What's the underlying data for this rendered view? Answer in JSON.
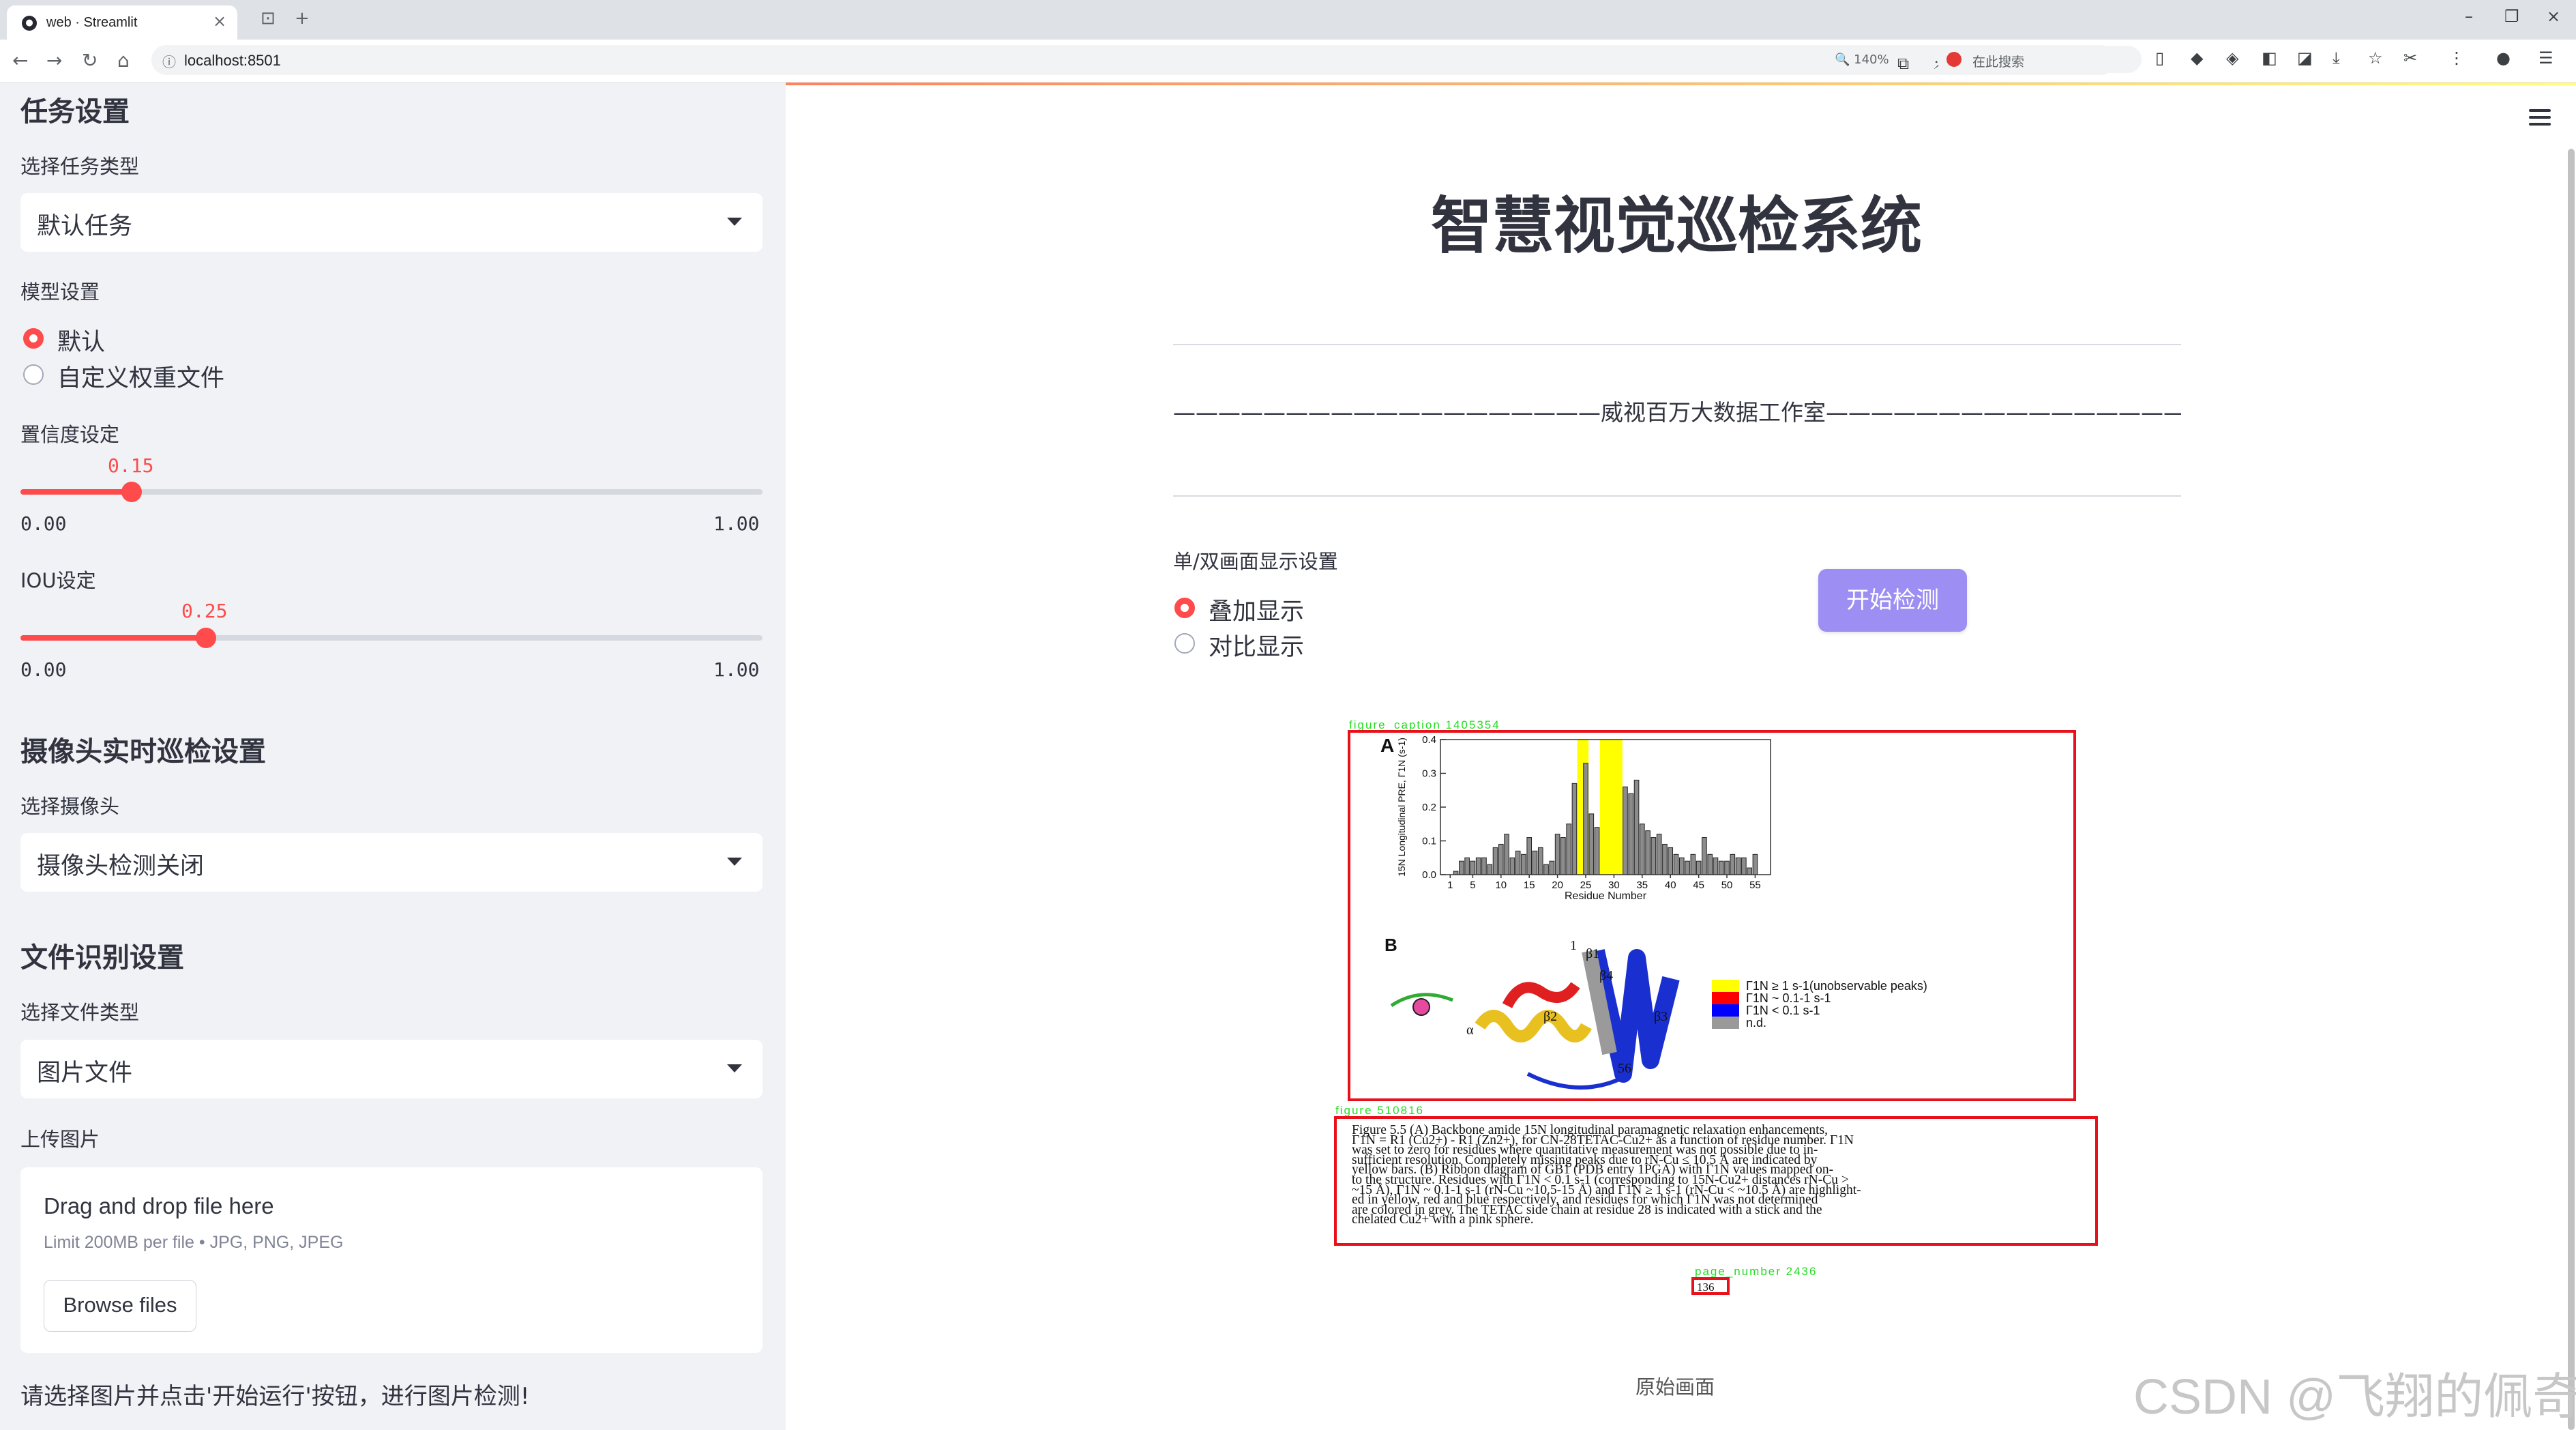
{
  "browser": {
    "tab_title": "web · Streamlit",
    "url": "localhost:8501",
    "zoom": "140%",
    "search_placeholder": "在此搜索"
  },
  "sidebar": {
    "task_heading": "任务设置",
    "task_type_label": "选择任务类型",
    "task_type_value": "默认任务",
    "model_label": "模型设置",
    "model_options": [
      "默认",
      "自定义权重文件"
    ],
    "model_selected": "默认",
    "conf_label": "置信度设定",
    "conf": {
      "value": 0.15,
      "value_text": "0.15",
      "min": "0.00",
      "max": "1.00"
    },
    "iou_label": "IOU设定",
    "iou": {
      "value": 0.25,
      "value_text": "0.25",
      "min": "0.00",
      "max": "1.00"
    },
    "camera_heading": "摄像头实时巡检设置",
    "camera_label": "选择摄像头",
    "camera_value": "摄像头检测关闭",
    "file_heading": "文件识别设置",
    "file_type_label": "选择文件类型",
    "file_type_value": "图片文件",
    "upload_label": "上传图片",
    "dropzone": {
      "title": "Drag and drop file here",
      "limit": "Limit 200MB per file • JPG, PNG, JPEG",
      "browse": "Browse files"
    },
    "hint": "请选择图片并点击'开始运行'按钮，进行图片检测!"
  },
  "main": {
    "title": "智慧视觉巡检系统",
    "studio": "———————————————————威视百万大数据工作室———————————————————",
    "display_label": "单/双画面显示设置",
    "display_options": [
      "叠加显示",
      "对比显示"
    ],
    "display_selected": "叠加显示",
    "start_button": "开始检测",
    "image_caption": "原始画面",
    "watermark": "CSDN @飞翔的佩奇"
  },
  "detections": [
    {
      "label": "figure_caption 1405354"
    },
    {
      "label": "figure 510816"
    },
    {
      "label": "page_number 2436"
    }
  ],
  "document": {
    "panel_a": "A",
    "panel_b": "B",
    "y_axis_label": "15N Longitudinal PRE, Γ1N (s-1)",
    "x_axis_label": "Residue Number",
    "legend": [
      {
        "text": "Γ1N ≥ 1 s-1(unobservable peaks)",
        "color": "#ffff00"
      },
      {
        "text": "Γ1N ~ 0.1-1 s-1",
        "color": "#ff0000"
      },
      {
        "text": "Γ1N < 0.1 s-1",
        "color": "#0000ff"
      },
      {
        "text": "n.d.",
        "color": "#9a9a9a"
      }
    ],
    "structure_labels": [
      "β1",
      "β4",
      "β3",
      "β2",
      "α",
      "56",
      "1"
    ],
    "caption_lines": [
      "Figure 5.5 (A) Backbone amide 15N longitudinal paramagnetic relaxation enhancements,",
      "Γ1N = R1 (Cu2+) - R1 (Zn2+), for CN-28TETAC-Cu2+ as a function of residue number. Γ1N",
      "was set to zero for residues where quantitative measurement was not possible due to in-",
      "sufficient resolution. Completely missing peaks due to rN-Cu ≤ 10.5 Å are indicated by",
      "yellow bars. (B) Ribbon diagram of GB1 (PDB entry 1PGA) with Γ1N values mapped on-",
      "to the structure. Residues with Γ1N < 0.1 s-1 (corresponding to 15N-Cu2+ distances rN-Cu >",
      "~15 Å), Γ1N ~ 0.1-1 s-1 (rN-Cu ~10.5-15 Å) and Γ1N ≥ 1 s-1 (rN-Cu < ~10.5 Å) are highlight-",
      "ed in yellow, red and blue respectively, and residues for which Γ1N was not determined",
      "are colored in grey. The TETAC side chain at residue 28 is indicated with a stick and the",
      "chelated Cu2+ with a pink sphere."
    ],
    "page_number": "136"
  },
  "chart_data": {
    "type": "bar",
    "title": "",
    "xlabel": "Residue Number",
    "ylabel": "15N Longitudinal PRE, Γ1N (s-1)",
    "ylim": [
      0,
      0.4
    ],
    "xlim": [
      0,
      57
    ],
    "x_ticks": [
      1,
      5,
      10,
      15,
      20,
      25,
      30,
      35,
      40,
      45,
      50,
      55
    ],
    "y_ticks": [
      "0.0",
      "0.1",
      "0.2",
      "0.3",
      "0.4"
    ],
    "highlight_ranges": [
      [
        24,
        25
      ],
      [
        28,
        31
      ]
    ],
    "highlight_color": "#ffff00",
    "grid": false,
    "x": [
      2,
      3,
      4,
      5,
      6,
      7,
      8,
      9,
      10,
      11,
      12,
      13,
      14,
      15,
      16,
      17,
      18,
      19,
      20,
      21,
      22,
      23,
      25,
      26,
      27,
      32,
      33,
      34,
      35,
      36,
      37,
      38,
      39,
      40,
      41,
      42,
      43,
      44,
      45,
      46,
      47,
      48,
      49,
      50,
      51,
      52,
      53,
      54,
      55
    ],
    "values": [
      0.01,
      0.04,
      0.05,
      0.04,
      0.05,
      0.05,
      0.03,
      0.08,
      0.09,
      0.12,
      0.05,
      0.07,
      0.06,
      0.11,
      0.07,
      0.08,
      0.03,
      0.04,
      0.12,
      0.11,
      0.15,
      0.27,
      0.33,
      0.18,
      0.14,
      0.26,
      0.24,
      0.28,
      0.15,
      0.13,
      0.11,
      0.12,
      0.09,
      0.08,
      0.06,
      0.05,
      0.04,
      0.06,
      0.04,
      0.11,
      0.06,
      0.05,
      0.04,
      0.04,
      0.06,
      0.05,
      0.05,
      0.02,
      0.06
    ]
  }
}
